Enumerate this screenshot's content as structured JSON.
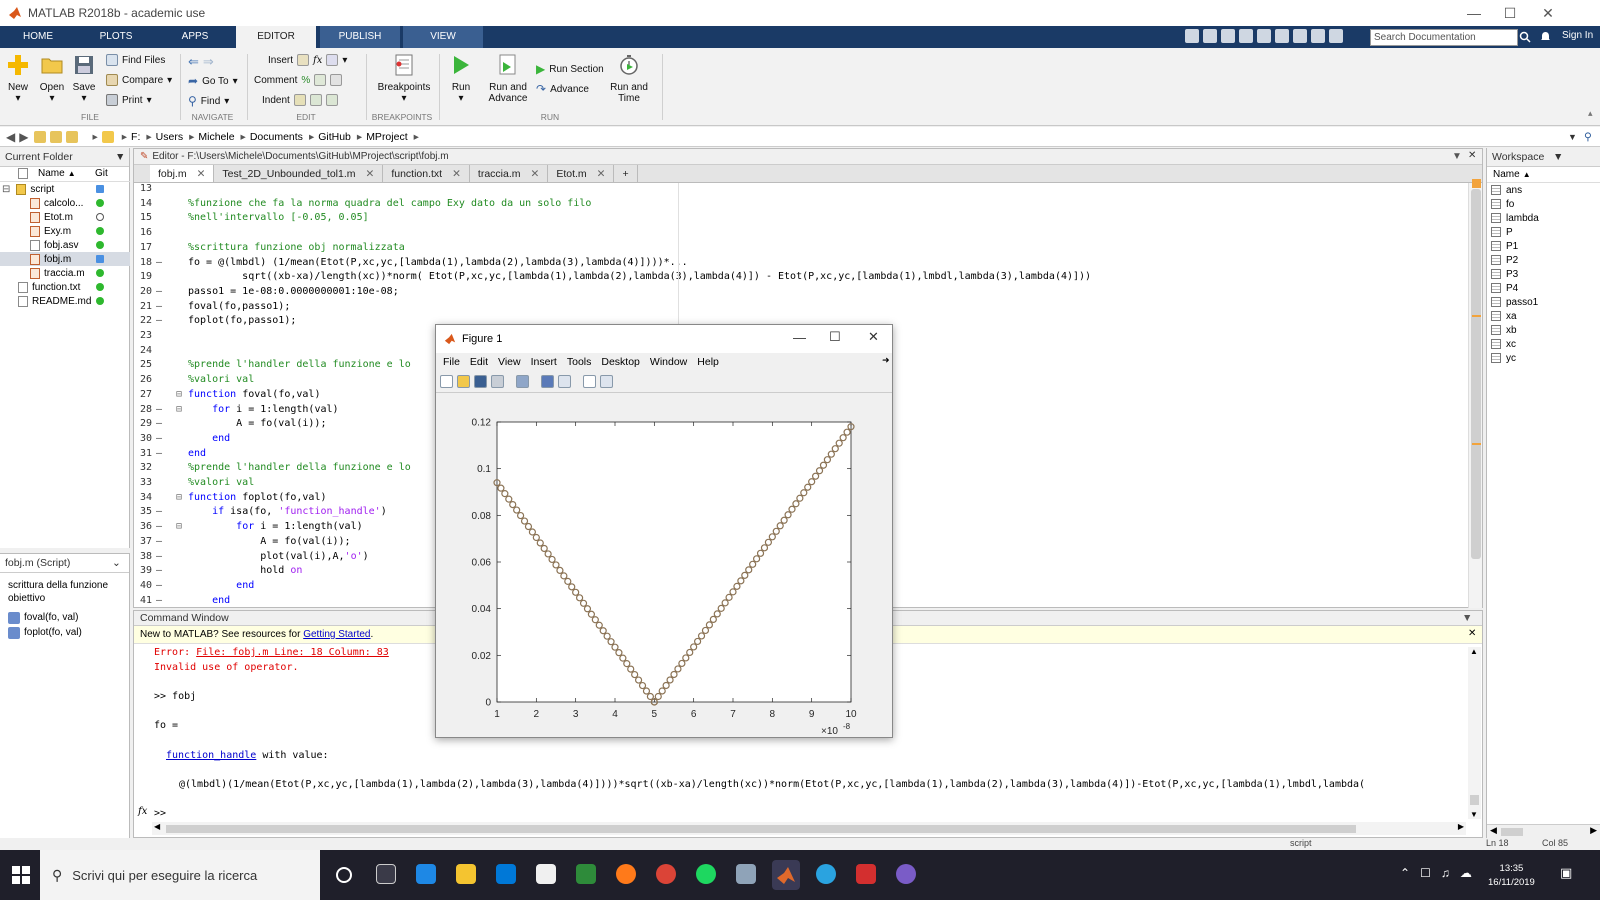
{
  "window": {
    "title": "MATLAB R2018b - academic use"
  },
  "ribbon": {
    "tabs": [
      "HOME",
      "PLOTS",
      "APPS",
      "EDITOR",
      "PUBLISH",
      "VIEW"
    ],
    "search_placeholder": "Search Documentation",
    "sign_in": "Sign In",
    "file": {
      "new": "New",
      "open": "Open",
      "save": "Save",
      "find_files": "Find Files",
      "compare": "Compare",
      "print": "Print"
    },
    "navigate": {
      "go_to": "Go To",
      "find": "Find"
    },
    "edit": {
      "insert": "Insert",
      "fx": "fx",
      "comment": "Comment",
      "comment_icon": "%",
      "indent": "Indent"
    },
    "breakpoints": {
      "breakpoints": "Breakpoints"
    },
    "run": {
      "run": "Run",
      "run_and_advance_1": "Run and",
      "run_and_advance_2": "Advance",
      "run_section": "Run Section",
      "advance": "Advance",
      "run_and_time_1": "Run and",
      "run_and_time_2": "Time"
    },
    "groups": [
      "FILE",
      "NAVIGATE",
      "EDIT",
      "BREAKPOINTS",
      "RUN"
    ]
  },
  "address": {
    "crumbs": [
      "F:",
      "Users",
      "Michele",
      "Documents",
      "GitHub",
      "MProject"
    ]
  },
  "current_folder": {
    "title": "Current Folder",
    "col_name": "Name",
    "col_git": "Git",
    "items": [
      {
        "name": "script",
        "type": "folder",
        "git": "#4a90e2"
      },
      {
        "name": "calcolo...",
        "type": "m",
        "git": "#2eb82e"
      },
      {
        "name": "Etot.m",
        "type": "m",
        "git": "none"
      },
      {
        "name": "Exy.m",
        "type": "m",
        "git": "#2eb82e"
      },
      {
        "name": "fobj.asv",
        "type": "file",
        "git": "#2eb82e"
      },
      {
        "name": "fobj.m",
        "type": "m",
        "git": "#4a90e2"
      },
      {
        "name": "traccia.m",
        "type": "m",
        "git": "#2eb82e"
      },
      {
        "name": "function.txt",
        "type": "file",
        "git": "#2eb82e"
      },
      {
        "name": "README.md",
        "type": "file",
        "git": "#2eb82e"
      }
    ],
    "details_title": "fobj.m  (Script)",
    "details_desc_1": "scrittura della funzione",
    "details_desc_2": "obiettivo",
    "details_fns": [
      "foval(fo, val)",
      "foplot(fo, val)"
    ]
  },
  "editor": {
    "header": "Editor - F:\\Users\\Michele\\Documents\\GitHub\\MProject\\script\\fobj.m",
    "tabs": [
      "fobj.m",
      "Test_2D_Unbounded_tol1.m",
      "function.txt",
      "traccia.m",
      "Etot.m"
    ],
    "plus": "+",
    "lines": [
      {
        "n": "13",
        "d": "",
        "t": ""
      },
      {
        "n": "14",
        "d": "",
        "t": "%funzione che fa la norma quadra del campo Exy dato da un solo filo"
      },
      {
        "n": "15",
        "d": "",
        "t": "%nell'intervallo [-0.05, 0.05]"
      },
      {
        "n": "16",
        "d": "",
        "t": ""
      },
      {
        "n": "17",
        "d": "",
        "t": "%scrittura funzione obj normalizzata"
      },
      {
        "n": "18",
        "d": "—",
        "t": "fo = @(lmbdl) (1/mean(Etot(P,xc,yc,[lambda(1),lambda(2),lambda(3),lambda(4)])))*..."
      },
      {
        "n": "19",
        "d": "",
        "t": "         sqrt((xb-xa)/length(xc))*norm( Etot(P,xc,yc,[lambda(1),lambda(2),lambda(3),lambda(4)]) - Etot(P,xc,yc,[lambda(1),lmbdl,lambda(3),lambda(4)]))"
      },
      {
        "n": "20",
        "d": "—",
        "t": "passo1 = 1e-08:0.0000000001:10e-08;"
      },
      {
        "n": "21",
        "d": "—",
        "t": "foval(fo,passo1);"
      },
      {
        "n": "22",
        "d": "—",
        "t": "foplot(fo,passo1);"
      },
      {
        "n": "23",
        "d": "",
        "t": ""
      },
      {
        "n": "24",
        "d": "",
        "t": ""
      },
      {
        "n": "25",
        "d": "",
        "t": "%prende l'handler della funzione e lo"
      },
      {
        "n": "26",
        "d": "",
        "t": "%valori val"
      },
      {
        "n": "27",
        "d": "",
        "t": "function foval(fo,val)"
      },
      {
        "n": "28",
        "d": "—",
        "t": "    for i = 1:length(val)"
      },
      {
        "n": "29",
        "d": "—",
        "t": "        A = fo(val(i));"
      },
      {
        "n": "30",
        "d": "—",
        "t": "    end"
      },
      {
        "n": "31",
        "d": "—",
        "t": "end"
      },
      {
        "n": "32",
        "d": "",
        "t": "%prende l'handler della funzione e lo"
      },
      {
        "n": "33",
        "d": "",
        "t": "%valori val"
      },
      {
        "n": "34",
        "d": "",
        "t": "function foplot(fo,val)"
      },
      {
        "n": "35",
        "d": "—",
        "t": "    if isa(fo, 'function_handle')"
      },
      {
        "n": "36",
        "d": "—",
        "t": "        for i = 1:length(val)"
      },
      {
        "n": "37",
        "d": "—",
        "t": "            A = fo(val(i));"
      },
      {
        "n": "38",
        "d": "—",
        "t": "            plot(val(i),A,'o')"
      },
      {
        "n": "39",
        "d": "—",
        "t": "            hold on"
      },
      {
        "n": "40",
        "d": "—",
        "t": "        end"
      },
      {
        "n": "41",
        "d": "—",
        "t": "    end"
      }
    ]
  },
  "workspace": {
    "title": "Workspace",
    "col_name": "Name",
    "vars": [
      "ans",
      "fo",
      "lambda",
      "P",
      "P1",
      "P2",
      "P3",
      "P4",
      "passo1",
      "xa",
      "xb",
      "xc",
      "yc"
    ]
  },
  "command_window": {
    "title": "Command Window",
    "new_msg": "New to MATLAB? See resources for ",
    "getting_started": "Getting Started",
    "new_msg_end": ".",
    "error_prefix": "Error: ",
    "error_link": "File: fobj.m Line: 18 Column: 83",
    "error_msg": "Invalid use of operator.",
    "prompt_cmd": ">> fobj",
    "fo_eq": "fo =",
    "fh_link": "function_handle",
    "fh_rest": " with value:",
    "fh_value": "@(lmbdl)(1/mean(Etot(P,xc,yc,[lambda(1),lambda(2),lambda(3),lambda(4)])))*sqrt((xb-xa)/length(xc))*norm(Etot(P,xc,yc,[lambda(1),lambda(2),lambda(3),lambda(4)])-Etot(P,xc,yc,[lambda(1),lmbdl,lambda(",
    "prompt": ">>",
    "fx": "fx"
  },
  "status": {
    "context": "script",
    "ln": "Ln  18",
    "col": "Col  85"
  },
  "taskbar": {
    "search_placeholder": "Scrivi qui per eseguire la ricerca",
    "time": "13:35",
    "date": "16/11/2019"
  },
  "figure": {
    "title": "Figure 1",
    "menu": [
      "File",
      "Edit",
      "View",
      "Insert",
      "Tools",
      "Desktop",
      "Window",
      "Help"
    ],
    "exponent": "×10",
    "exponent_power": "-8"
  },
  "chart_data": {
    "type": "scatter",
    "marker": "o",
    "x_scale_note": "×10^-8",
    "xlim": [
      1,
      10
    ],
    "ylim": [
      0,
      0.12
    ],
    "xticks": [
      "1",
      "2",
      "3",
      "4",
      "5",
      "6",
      "7",
      "8",
      "9",
      "10"
    ],
    "yticks": [
      "0",
      "0.02",
      "0.04",
      "0.06",
      "0.08",
      "0.1",
      "0.12"
    ],
    "series": [
      {
        "color": "#8b7355",
        "segments": [
          {
            "x_start": 1,
            "x_end": 5,
            "y_start": 0.094,
            "y_end": 0
          },
          {
            "x_start": 5,
            "x_end": 10,
            "y_start": 0,
            "y_end": 0.118
          }
        ],
        "x_step": 0.1
      }
    ],
    "title": "",
    "xlabel": "",
    "ylabel": ""
  }
}
